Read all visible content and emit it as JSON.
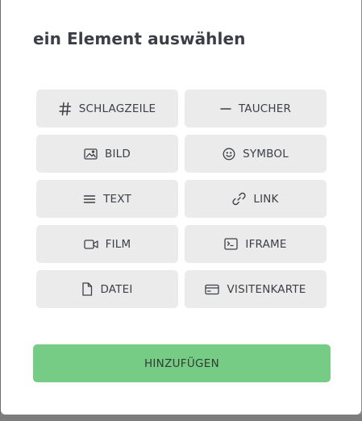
{
  "modal": {
    "title": "ein Element auswählen",
    "submit_label": "HINZUFÜGEN"
  },
  "elements": [
    {
      "label": "SCHLAGZEILE",
      "icon": "hash-icon"
    },
    {
      "label": "TAUCHER",
      "icon": "dash-icon"
    },
    {
      "label": "BILD",
      "icon": "image-icon"
    },
    {
      "label": "SYMBOL",
      "icon": "smiley-icon"
    },
    {
      "label": "TEXT",
      "icon": "text-lines-icon"
    },
    {
      "label": "LINK",
      "icon": "link-icon"
    },
    {
      "label": "FILM",
      "icon": "video-camera-icon"
    },
    {
      "label": "IFRAME",
      "icon": "terminal-window-icon"
    },
    {
      "label": "DATEI",
      "icon": "file-icon"
    },
    {
      "label": "VISITENKARTE",
      "icon": "card-icon"
    }
  ],
  "colors": {
    "button_bg": "#ebebeb",
    "submit_bg": "#77cc85",
    "text": "#3d4046"
  }
}
